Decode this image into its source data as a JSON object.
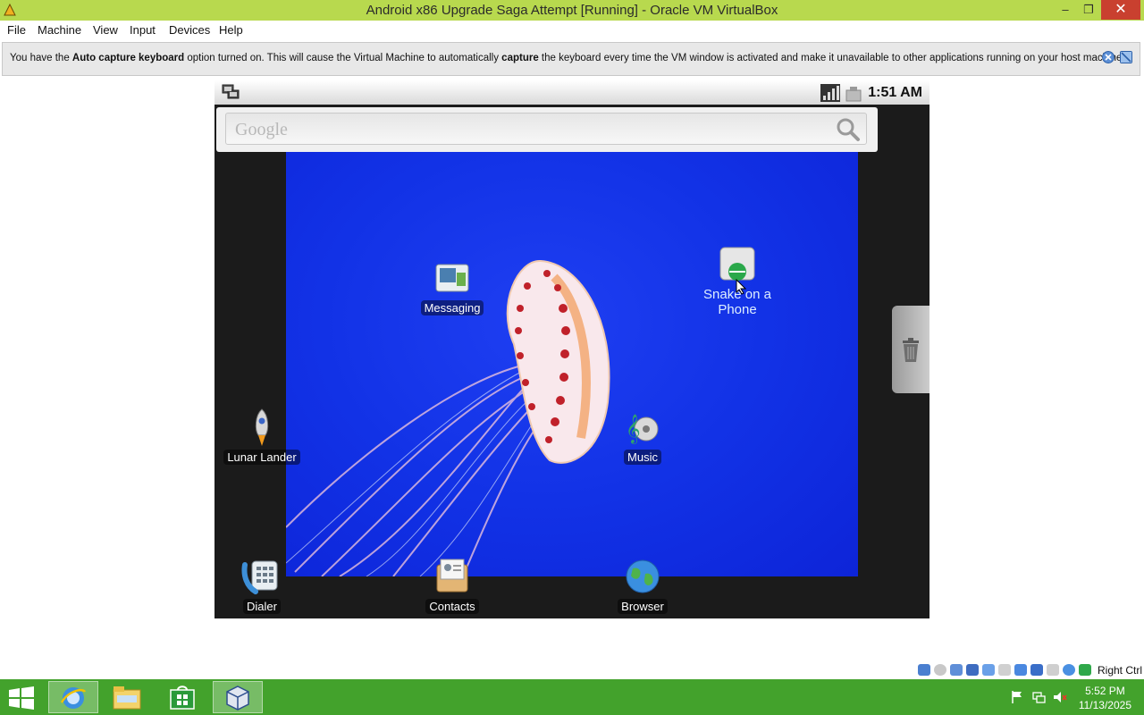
{
  "window": {
    "title": "Android x86 Upgrade Saga Attempt [Running] - Oracle VM VirtualBox",
    "minimize": "–",
    "restore": "❐",
    "close": "✕"
  },
  "menu": [
    "File",
    "Machine",
    "View",
    "Input",
    "Devices",
    "Help"
  ],
  "banner": {
    "t1": "You have the ",
    "b1": "Auto capture keyboard",
    "t2": " option turned on. This will cause the Virtual Machine to automatically ",
    "b2": "capture",
    "t3": " the keyboard every time the VM window is activated and make it unavailable to other applications running on your host machine:",
    "info_icon": "info-close-icon",
    "dismiss_icon": "dismiss-icon"
  },
  "android": {
    "time": "1:51 AM",
    "search_placeholder": "Google",
    "apps": {
      "messaging": "Messaging",
      "snake": "Snake on a Phone",
      "lunar": "Lunar Lander",
      "music": "Music",
      "dialer": "Dialer",
      "contacts": "Contacts",
      "browser": "Browser"
    }
  },
  "vbox_status": {
    "host_key": "Right Ctrl"
  },
  "taskbar": {
    "time": "5:52 PM",
    "date": "11/13/2025"
  },
  "colors": {
    "titlebar": "#b8d94e",
    "taskbar": "#43a22c",
    "wallpaper": "#1232e6",
    "close": "#c9402f"
  }
}
